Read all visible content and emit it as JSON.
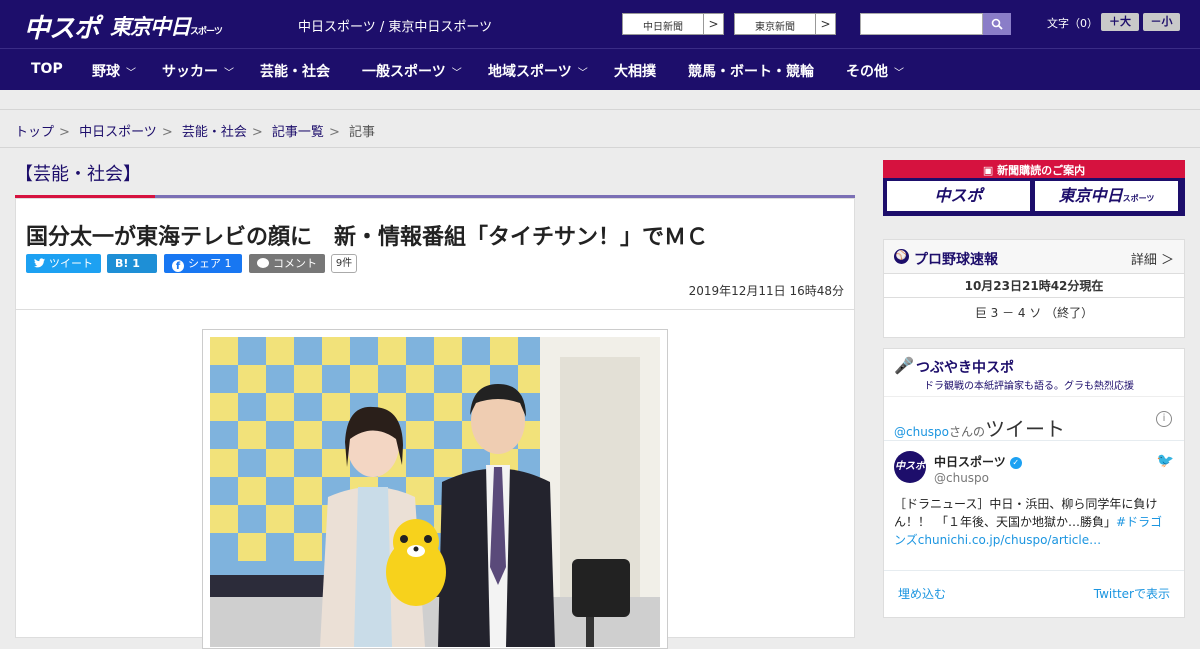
{
  "header": {
    "logo_chuspo": "中スポ",
    "logo_tokyo": "東京中日",
    "logo_tokyo_sub": "スポーツ",
    "site_link": "中日スポーツ / 東京中日スポーツ",
    "ext_links": [
      "中日新聞",
      "東京新聞"
    ],
    "search_placeholder": "",
    "fontsize_label": "文字（0）",
    "font_larger": "＋大",
    "font_smaller": "－小"
  },
  "nav": {
    "items": [
      {
        "label": "TOP",
        "dropdown": false
      },
      {
        "label": "野球",
        "dropdown": true
      },
      {
        "label": "サッカー",
        "dropdown": true
      },
      {
        "label": "芸能・社会",
        "dropdown": false
      },
      {
        "label": "一般スポーツ",
        "dropdown": true
      },
      {
        "label": "地域スポーツ",
        "dropdown": true
      },
      {
        "label": "大相撲",
        "dropdown": false
      },
      {
        "label": "競馬・ボート・競輪",
        "dropdown": false
      },
      {
        "label": "その他",
        "dropdown": true
      }
    ]
  },
  "breadcrumb": [
    "トップ",
    "中日スポーツ",
    "芸能・社会",
    "記事一覧",
    "記事"
  ],
  "article": {
    "category": "【芸能・社会】",
    "headline": "国分太一が東海テレビの顔に　新・情報番組「タイチサン！」でＭＣ",
    "share": {
      "tweet": "ツイート",
      "hatena": "B! 1",
      "facebook": "シェア 1",
      "comment": "コメント",
      "comment_count": "9件"
    },
    "date": "2019年12月11日 16時48分"
  },
  "sidebar": {
    "subscription_title": "新聞購読のご案内",
    "sub_btn_1": "中スポ",
    "sub_btn_2": "東京中日",
    "sub_btn_2_sub": "スポーツ",
    "baseball": {
      "title": "プロ野球速報",
      "more": "詳細 ＞",
      "time": "10月23日21時42分現在",
      "score": "巨 3 － 4 ソ （終了）"
    },
    "tweets": {
      "title": "つぶやき中スポ",
      "subtitle": "ドラ観戦の本紙評論家も語る。グラも熱烈応援",
      "handle": "@chuspo",
      "handle_suffix": "さんの",
      "handle_big": "ツイート",
      "name": "中日スポーツ",
      "user": "@chuspo",
      "avatar": "中スポ",
      "text": "［ドラニュース］中日・浜田、柳ら同学年に負けん！！　「１年後、天国か地獄か…勝負」",
      "text_link": "#ドラゴンズchunichi.co.jp/chuspo/article…",
      "embed": "埋め込む",
      "view": "Twitterで表示"
    }
  }
}
